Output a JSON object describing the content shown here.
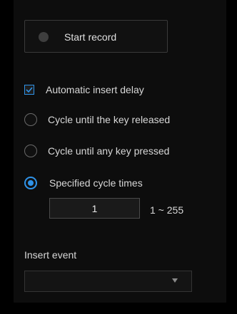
{
  "record": {
    "label": "Start record"
  },
  "options": {
    "auto_delay": {
      "label": "Automatic insert delay",
      "checked": true
    },
    "cycle_key_released": {
      "label": "Cycle until the key released",
      "selected": false
    },
    "cycle_any_key": {
      "label": "Cycle until any key pressed",
      "selected": false
    },
    "specified_times": {
      "label": "Specified cycle times",
      "selected": true
    }
  },
  "cycle": {
    "value": "1",
    "range": "1 ~ 255"
  },
  "insert_event": {
    "label": "Insert event",
    "selected": ""
  },
  "colors": {
    "accent": "#2f93e8",
    "background": "#000000",
    "panel": "#0d0d0d"
  }
}
